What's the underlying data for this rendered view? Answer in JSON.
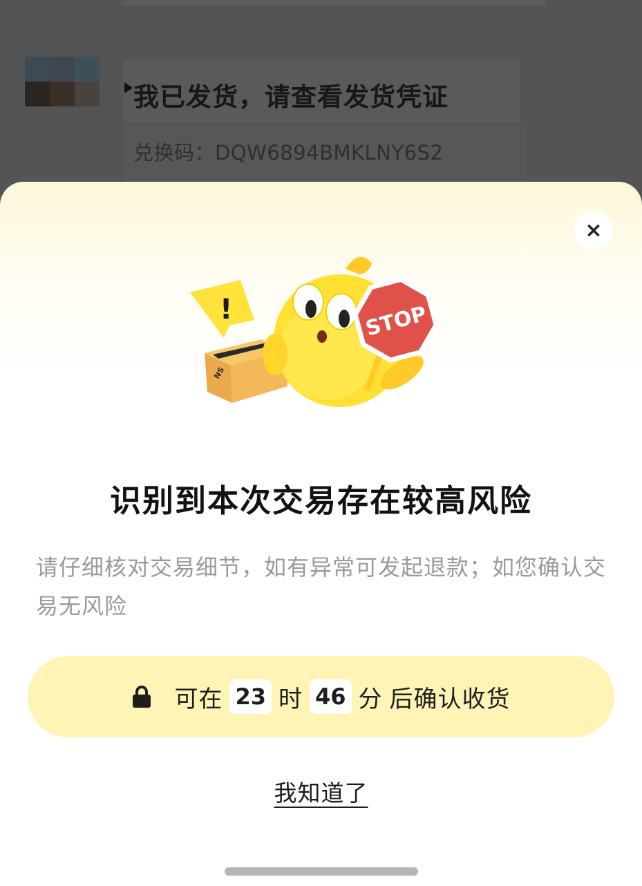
{
  "chat": {
    "message": "我已发货，请查看发货凭证",
    "redeem_code": "兑换码：DQW6894BMKLNY6S2"
  },
  "modal": {
    "close_symbol": "×",
    "illustration": {
      "sign_text": "STOP",
      "alert_symbol": "!",
      "box_label": "NS"
    },
    "title": "识别到本次交易存在较高风险",
    "description": "请仔细核对交易细节，如有异常可发起退款；如您确认交易无风险",
    "confirm": {
      "icon": "lock-icon",
      "prefix": "可在",
      "hours": "23",
      "hours_unit": "时",
      "minutes": "46",
      "minutes_unit": "分",
      "suffix": "后确认收货"
    },
    "ok_label": "我知道了"
  },
  "colors": {
    "confirm_bar_bg": "#fef4b6",
    "title": "#121212",
    "description": "#9a9a9a",
    "stop_sign": "#e0514a",
    "mascot": "#ffe033"
  }
}
